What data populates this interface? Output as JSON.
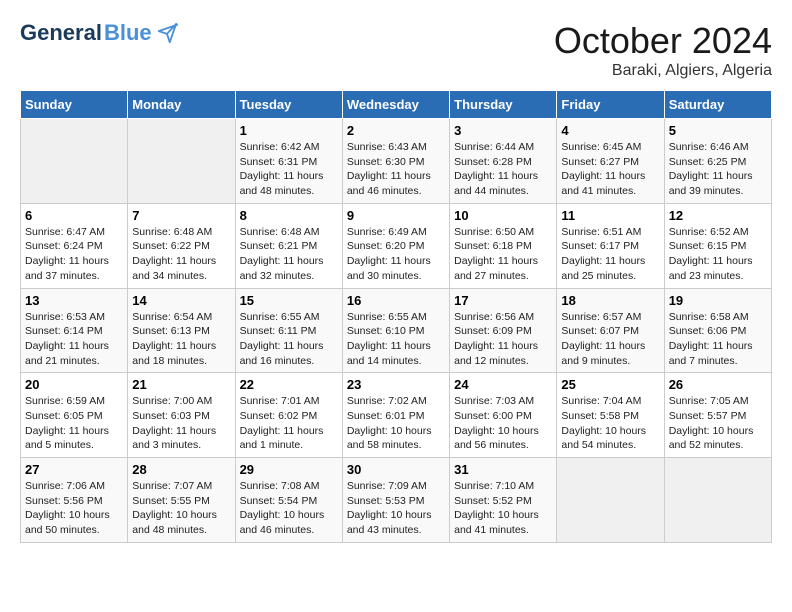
{
  "header": {
    "logo_general": "General",
    "logo_blue": "Blue",
    "month_title": "October 2024",
    "location": "Baraki, Algiers, Algeria"
  },
  "weekdays": [
    "Sunday",
    "Monday",
    "Tuesday",
    "Wednesday",
    "Thursday",
    "Friday",
    "Saturday"
  ],
  "weeks": [
    [
      {
        "day": "",
        "info": ""
      },
      {
        "day": "",
        "info": ""
      },
      {
        "day": "1",
        "info": "Sunrise: 6:42 AM\nSunset: 6:31 PM\nDaylight: 11 hours and 48 minutes."
      },
      {
        "day": "2",
        "info": "Sunrise: 6:43 AM\nSunset: 6:30 PM\nDaylight: 11 hours and 46 minutes."
      },
      {
        "day": "3",
        "info": "Sunrise: 6:44 AM\nSunset: 6:28 PM\nDaylight: 11 hours and 44 minutes."
      },
      {
        "day": "4",
        "info": "Sunrise: 6:45 AM\nSunset: 6:27 PM\nDaylight: 11 hours and 41 minutes."
      },
      {
        "day": "5",
        "info": "Sunrise: 6:46 AM\nSunset: 6:25 PM\nDaylight: 11 hours and 39 minutes."
      }
    ],
    [
      {
        "day": "6",
        "info": "Sunrise: 6:47 AM\nSunset: 6:24 PM\nDaylight: 11 hours and 37 minutes."
      },
      {
        "day": "7",
        "info": "Sunrise: 6:48 AM\nSunset: 6:22 PM\nDaylight: 11 hours and 34 minutes."
      },
      {
        "day": "8",
        "info": "Sunrise: 6:48 AM\nSunset: 6:21 PM\nDaylight: 11 hours and 32 minutes."
      },
      {
        "day": "9",
        "info": "Sunrise: 6:49 AM\nSunset: 6:20 PM\nDaylight: 11 hours and 30 minutes."
      },
      {
        "day": "10",
        "info": "Sunrise: 6:50 AM\nSunset: 6:18 PM\nDaylight: 11 hours and 27 minutes."
      },
      {
        "day": "11",
        "info": "Sunrise: 6:51 AM\nSunset: 6:17 PM\nDaylight: 11 hours and 25 minutes."
      },
      {
        "day": "12",
        "info": "Sunrise: 6:52 AM\nSunset: 6:15 PM\nDaylight: 11 hours and 23 minutes."
      }
    ],
    [
      {
        "day": "13",
        "info": "Sunrise: 6:53 AM\nSunset: 6:14 PM\nDaylight: 11 hours and 21 minutes."
      },
      {
        "day": "14",
        "info": "Sunrise: 6:54 AM\nSunset: 6:13 PM\nDaylight: 11 hours and 18 minutes."
      },
      {
        "day": "15",
        "info": "Sunrise: 6:55 AM\nSunset: 6:11 PM\nDaylight: 11 hours and 16 minutes."
      },
      {
        "day": "16",
        "info": "Sunrise: 6:55 AM\nSunset: 6:10 PM\nDaylight: 11 hours and 14 minutes."
      },
      {
        "day": "17",
        "info": "Sunrise: 6:56 AM\nSunset: 6:09 PM\nDaylight: 11 hours and 12 minutes."
      },
      {
        "day": "18",
        "info": "Sunrise: 6:57 AM\nSunset: 6:07 PM\nDaylight: 11 hours and 9 minutes."
      },
      {
        "day": "19",
        "info": "Sunrise: 6:58 AM\nSunset: 6:06 PM\nDaylight: 11 hours and 7 minutes."
      }
    ],
    [
      {
        "day": "20",
        "info": "Sunrise: 6:59 AM\nSunset: 6:05 PM\nDaylight: 11 hours and 5 minutes."
      },
      {
        "day": "21",
        "info": "Sunrise: 7:00 AM\nSunset: 6:03 PM\nDaylight: 11 hours and 3 minutes."
      },
      {
        "day": "22",
        "info": "Sunrise: 7:01 AM\nSunset: 6:02 PM\nDaylight: 11 hours and 1 minute."
      },
      {
        "day": "23",
        "info": "Sunrise: 7:02 AM\nSunset: 6:01 PM\nDaylight: 10 hours and 58 minutes."
      },
      {
        "day": "24",
        "info": "Sunrise: 7:03 AM\nSunset: 6:00 PM\nDaylight: 10 hours and 56 minutes."
      },
      {
        "day": "25",
        "info": "Sunrise: 7:04 AM\nSunset: 5:58 PM\nDaylight: 10 hours and 54 minutes."
      },
      {
        "day": "26",
        "info": "Sunrise: 7:05 AM\nSunset: 5:57 PM\nDaylight: 10 hours and 52 minutes."
      }
    ],
    [
      {
        "day": "27",
        "info": "Sunrise: 7:06 AM\nSunset: 5:56 PM\nDaylight: 10 hours and 50 minutes."
      },
      {
        "day": "28",
        "info": "Sunrise: 7:07 AM\nSunset: 5:55 PM\nDaylight: 10 hours and 48 minutes."
      },
      {
        "day": "29",
        "info": "Sunrise: 7:08 AM\nSunset: 5:54 PM\nDaylight: 10 hours and 46 minutes."
      },
      {
        "day": "30",
        "info": "Sunrise: 7:09 AM\nSunset: 5:53 PM\nDaylight: 10 hours and 43 minutes."
      },
      {
        "day": "31",
        "info": "Sunrise: 7:10 AM\nSunset: 5:52 PM\nDaylight: 10 hours and 41 minutes."
      },
      {
        "day": "",
        "info": ""
      },
      {
        "day": "",
        "info": ""
      }
    ]
  ]
}
